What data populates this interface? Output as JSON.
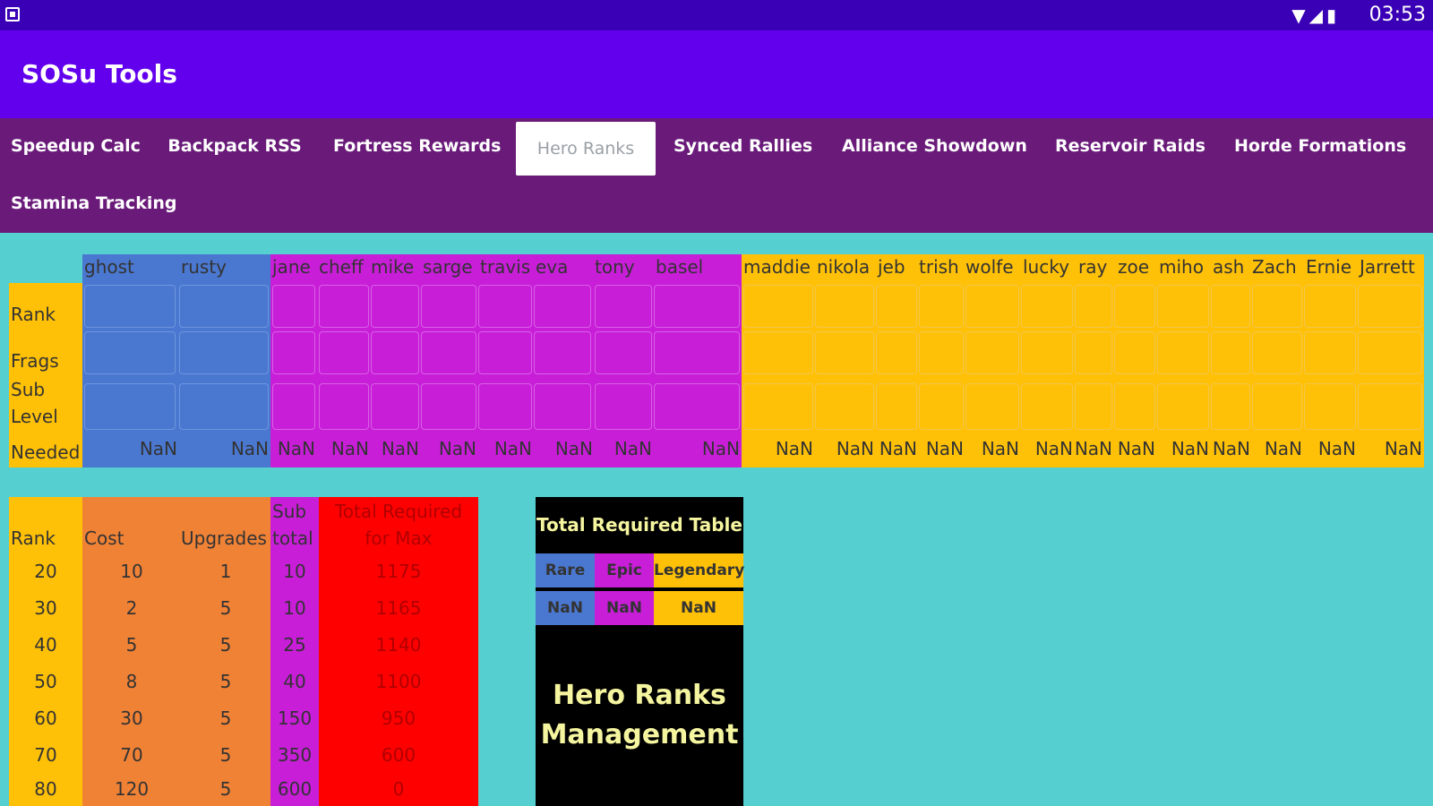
{
  "status": {
    "time": "03:53",
    "icons_text": "▼◢▮"
  },
  "app": {
    "title": "SOSu Tools"
  },
  "tabs": [
    {
      "label": "Speedup Calc"
    },
    {
      "label": "Backpack RSS"
    },
    {
      "label": "Fortress Rewards"
    },
    {
      "label": "Hero Ranks"
    },
    {
      "label": "Synced Rallies"
    },
    {
      "label": "Alliance Showdown"
    },
    {
      "label": "Reservoir Raids"
    },
    {
      "label": "Horde Formations"
    },
    {
      "label": "Stamina Tracking"
    }
  ],
  "row_labels": {
    "rank": "Rank",
    "frags": "Frags",
    "sub": "Sub",
    "level": "Level",
    "needed": "Needed"
  },
  "heroes": [
    {
      "name": "ghost",
      "needed": "NaN"
    },
    {
      "name": "rusty",
      "needed": "NaN"
    },
    {
      "name": "jane",
      "needed": "NaN"
    },
    {
      "name": "cheff",
      "needed": "NaN"
    },
    {
      "name": "mike",
      "needed": "NaN"
    },
    {
      "name": "sarge",
      "needed": "NaN"
    },
    {
      "name": "travis",
      "needed": "NaN"
    },
    {
      "name": "eva",
      "needed": "NaN"
    },
    {
      "name": "tony",
      "needed": "NaN"
    },
    {
      "name": "basel",
      "needed": "NaN"
    },
    {
      "name": "maddie",
      "needed": "NaN"
    },
    {
      "name": "nikola",
      "needed": "NaN"
    },
    {
      "name": "jeb",
      "needed": "NaN"
    },
    {
      "name": "trish",
      "needed": "NaN"
    },
    {
      "name": "wolfe",
      "needed": "NaN"
    },
    {
      "name": "lucky",
      "needed": "NaN"
    },
    {
      "name": "ray",
      "needed": "NaN"
    },
    {
      "name": "zoe",
      "needed": "NaN"
    },
    {
      "name": "miho",
      "needed": "NaN"
    },
    {
      "name": "ash",
      "needed": "NaN"
    },
    {
      "name": "Zach",
      "needed": "NaN"
    },
    {
      "name": "Ernie",
      "needed": "NaN"
    },
    {
      "name": "Jarrett",
      "needed": "NaN"
    }
  ],
  "colors": {
    "rare": "#4a78d0",
    "epic": "#c81ed8",
    "legendary": "#ffc107",
    "cost": "#f08236",
    "total": "#ff0000",
    "bg": "#55cfcf",
    "appbar": "#6200ee",
    "tabbar": "#6a1b7a"
  },
  "ranks_table": {
    "headers": {
      "rank": "Rank",
      "cost": "Cost",
      "upgrades": "Upgrades",
      "sub1": "Sub",
      "sub2": "total",
      "total1": "Total Required",
      "total2": "for Max"
    },
    "rows": [
      {
        "rank": "20",
        "cost": "10",
        "upgrades": "1",
        "subtotal": "10",
        "total": "1175"
      },
      {
        "rank": "30",
        "cost": "2",
        "upgrades": "5",
        "subtotal": "10",
        "total": "1165"
      },
      {
        "rank": "40",
        "cost": "5",
        "upgrades": "5",
        "subtotal": "25",
        "total": "1140"
      },
      {
        "rank": "50",
        "cost": "8",
        "upgrades": "5",
        "subtotal": "40",
        "total": "1100"
      },
      {
        "rank": "60",
        "cost": "30",
        "upgrades": "5",
        "subtotal": "150",
        "total": "950"
      },
      {
        "rank": "70",
        "cost": "70",
        "upgrades": "5",
        "subtotal": "350",
        "total": "600"
      },
      {
        "rank": "80",
        "cost": "120",
        "upgrades": "5",
        "subtotal": "600",
        "total": "0"
      }
    ]
  },
  "total_required": {
    "title": "Total Required Table",
    "rare_label": "Rare",
    "epic_label": "Epic",
    "legendary_label": "Legendary",
    "rare_value": "NaN",
    "epic_value": "NaN",
    "legendary_value": "NaN",
    "caption1": "Hero Ranks",
    "caption2": "Management"
  }
}
